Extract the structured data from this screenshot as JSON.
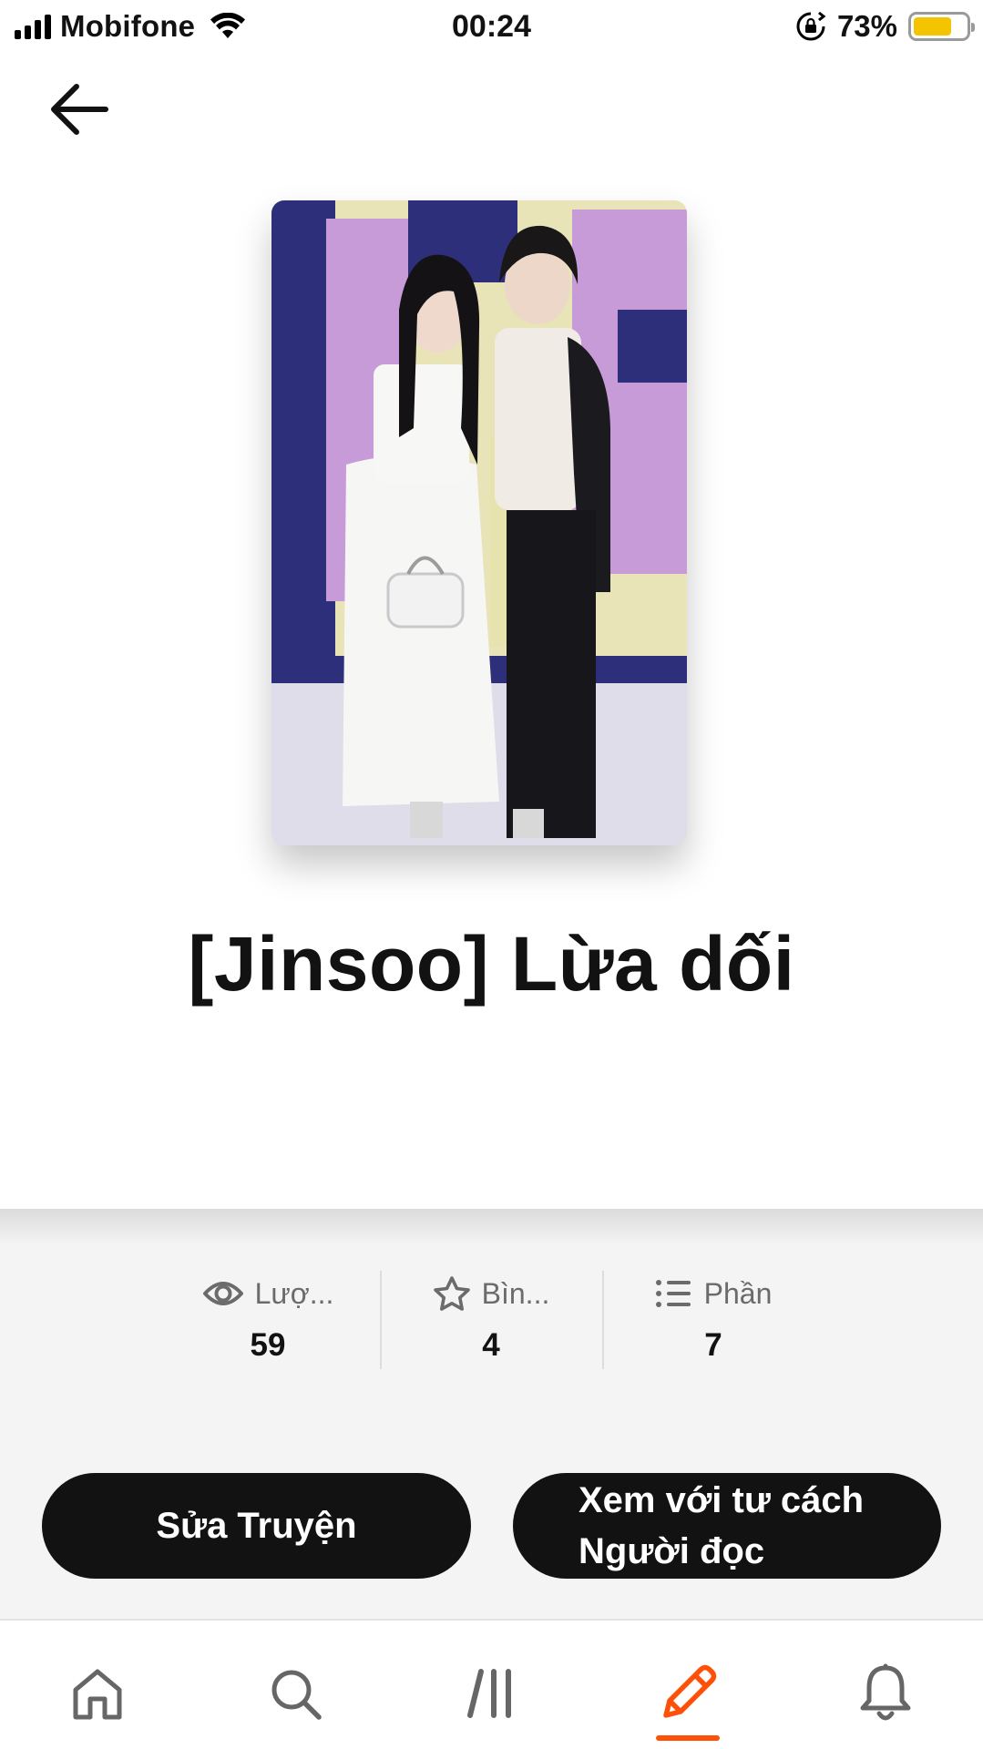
{
  "status_bar": {
    "carrier": "Mobifone",
    "time": "00:24",
    "battery_percent": "73%",
    "battery_level": 0.73,
    "battery_color": "#f5c400"
  },
  "header": {
    "back_icon": "arrow-left-icon"
  },
  "story": {
    "title": "[Jinsoo] Lừa dối",
    "cover_icon": "story-cover-image"
  },
  "stats": [
    {
      "icon": "eye-icon",
      "label": "Lượ...",
      "value": "59"
    },
    {
      "icon": "star-icon",
      "label": "Bìn...",
      "value": "4"
    },
    {
      "icon": "list-icon",
      "label": "Phần",
      "value": "7"
    }
  ],
  "actions": {
    "edit_label": "Sửa Truyện",
    "reader_label_line1": "Xem với tư cách",
    "reader_label_line2": "Người đọc"
  },
  "bottom_nav": {
    "items": [
      {
        "icon": "home-icon",
        "active": false
      },
      {
        "icon": "search-icon",
        "active": false
      },
      {
        "icon": "library-icon",
        "active": false
      },
      {
        "icon": "pencil-icon",
        "active": true
      },
      {
        "icon": "bell-icon",
        "active": false
      }
    ],
    "accent_color": "#ff500a"
  }
}
